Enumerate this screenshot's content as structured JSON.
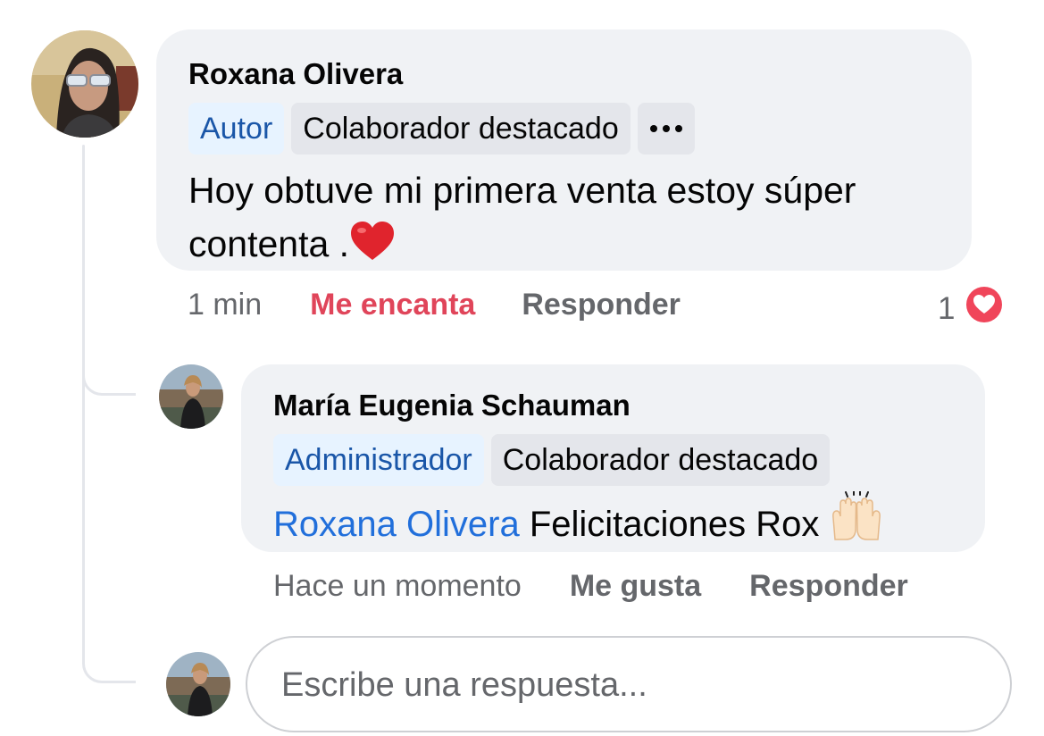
{
  "comment": {
    "author": "Roxana Olivera",
    "badges": [
      "Autor",
      "Colaborador destacado"
    ],
    "text": "Hoy obtuve mi primera venta estoy súper contenta .",
    "text_emoji": "red-heart",
    "time": "1 min",
    "reaction_label": "Me encanta",
    "reply_label": "Responder",
    "reaction_count": "1",
    "reaction_icon": "love-reaction-icon"
  },
  "reply": {
    "author": "María Eugenia Schauman",
    "badges": [
      "Administrador",
      "Colaborador destacado"
    ],
    "mention": "Roxana Olivera",
    "text": "Felicitaciones Rox",
    "text_emoji": "raising-hands",
    "time": "Hace un momento",
    "like_label": "Me gusta",
    "reply_label": "Responder"
  },
  "reply_input": {
    "placeholder": "Escribe una respuesta..."
  },
  "colors": {
    "bubble": "#f0f2f5",
    "badge_blue_bg": "#e7f3ff",
    "badge_blue_text": "#1a56a8",
    "badge_gray_bg": "#e4e6eb",
    "mention": "#216fdb",
    "love": "#e0455a",
    "secondary_text": "#65676b"
  }
}
